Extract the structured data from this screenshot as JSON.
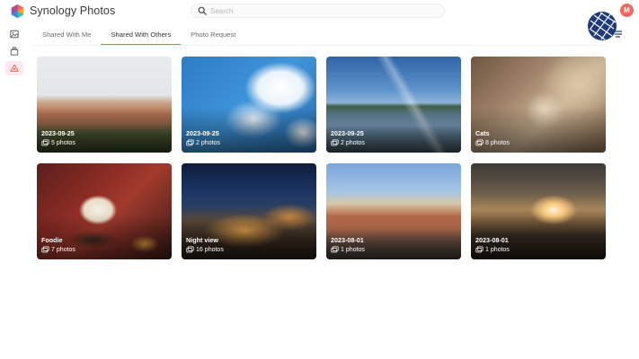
{
  "app": {
    "title": "Synology Photos"
  },
  "search": {
    "placeholder": "Search",
    "value": ""
  },
  "user": {
    "initial": "M",
    "avatar_color": "#f0675e"
  },
  "sidebar": {
    "items": [
      {
        "name": "photos",
        "icon": "image-icon",
        "active": false
      },
      {
        "name": "albums",
        "icon": "album-icon",
        "active": false
      },
      {
        "name": "sharing",
        "icon": "share-icon",
        "active": true
      }
    ]
  },
  "tabs": [
    {
      "label": "Shared With Me",
      "active": false
    },
    {
      "label": "Shared With Others",
      "active": true
    },
    {
      "label": "Photo Request",
      "active": false
    }
  ],
  "accent_color": "#f0675e",
  "albums": [
    {
      "title": "2023-09-25",
      "count": "5",
      "unit": "photos"
    },
    {
      "title": "2023-09-25",
      "count": "2",
      "unit": "photos"
    },
    {
      "title": "2023-09-25",
      "count": "2",
      "unit": "photos"
    },
    {
      "title": "Cats",
      "count": "8",
      "unit": "photos"
    },
    {
      "title": "Foodie",
      "count": "7",
      "unit": "photos"
    },
    {
      "title": "Night view",
      "count": "16",
      "unit": "photos"
    },
    {
      "title": "2023-08-01",
      "count": "1",
      "unit": "photos"
    },
    {
      "title": "2023-08-01",
      "count": "1",
      "unit": "photos"
    }
  ]
}
